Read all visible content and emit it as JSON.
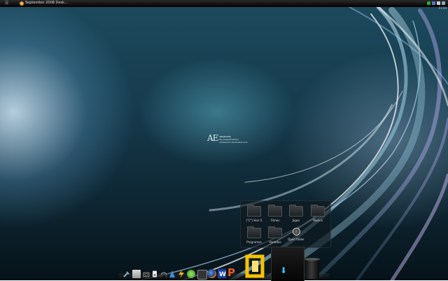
{
  "taskbar": {
    "start_glyph": "☰",
    "window_title": "September 2008 Desk..."
  },
  "clock": "11:04",
  "logo": {
    "mark": "AE",
    "line1": "Abstracto",
    "line2": "By AsiaexFreedom",
    "line3": "indexación.deviantart.com"
  },
  "folders": [
    {
      "label": "(\"C\") Hari X"
    },
    {
      "label": "Filmes"
    },
    {
      "label": "Jogos"
    },
    {
      "label": "Música"
    },
    {
      "label": "Programas"
    },
    {
      "label": "Variados"
    },
    {
      "label": "Open folder"
    }
  ],
  "dock": {
    "download_arrow": "⬇"
  },
  "colors": {
    "accent": "#39c0ff",
    "taskbar": "#0a0a0a"
  }
}
